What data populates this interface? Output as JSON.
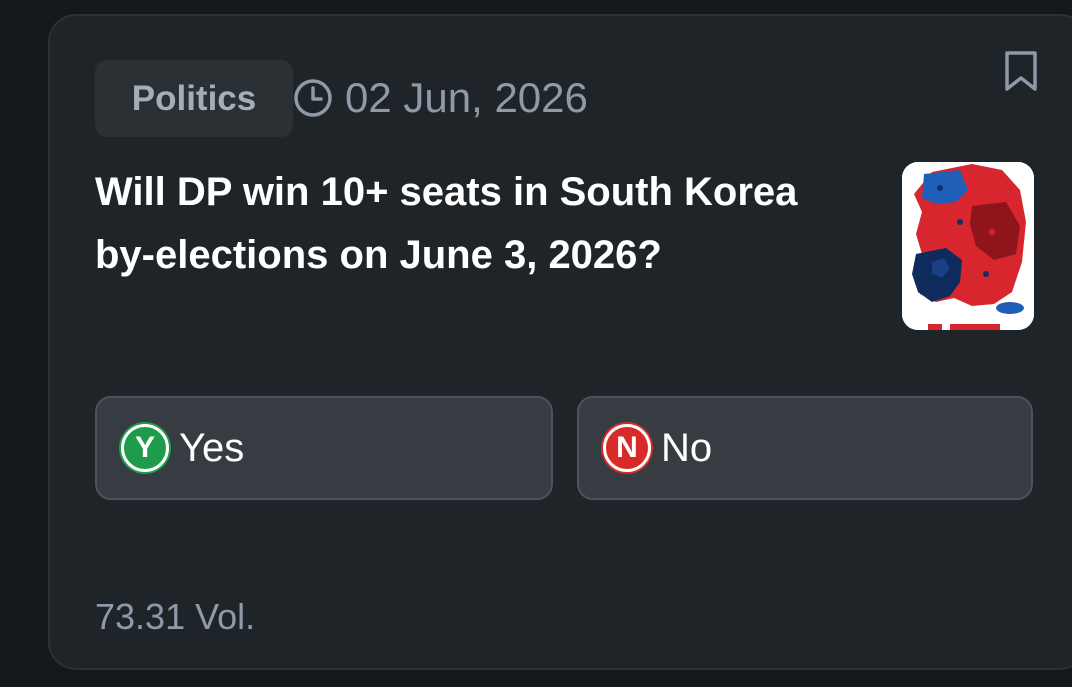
{
  "card": {
    "category": "Politics",
    "date": "02 Jun, 2026",
    "question": "Will DP win 10+ seats in South Korea by-elections on June 3, 2026?",
    "thumbnail_icon": "south-korea-election-map",
    "options": [
      {
        "badge": "Y",
        "label": "Yes",
        "color": "#1f9b4c"
      },
      {
        "badge": "N",
        "label": "No",
        "color": "#d92a2a"
      }
    ],
    "volume": "73.31 Vol."
  },
  "icons": {
    "clock": "clock-icon",
    "bookmark": "bookmark-icon"
  },
  "colors": {
    "background": "#15181b",
    "card": "#1f2428",
    "option_bg": "#363c42",
    "muted_text": "#8e9aa7"
  }
}
